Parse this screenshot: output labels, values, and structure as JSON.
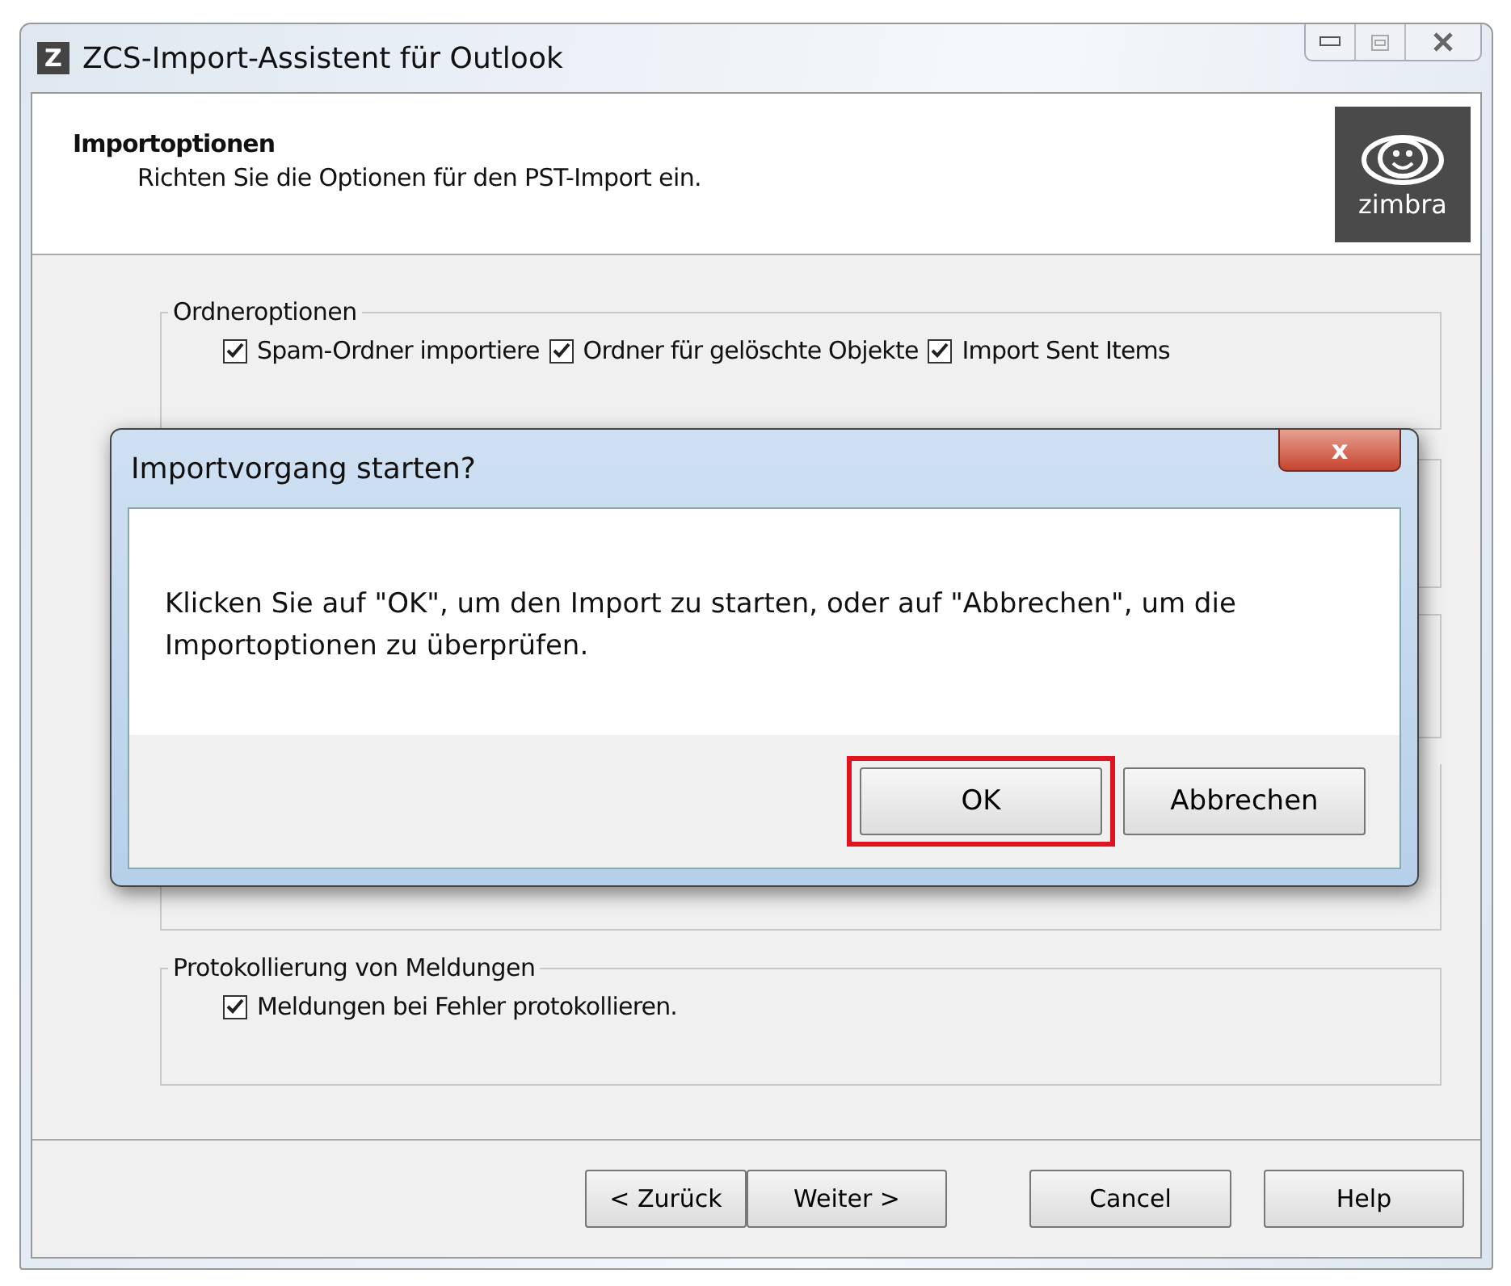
{
  "window": {
    "title": "ZCS-Import-Assistent für Outlook",
    "app_icon": "Z"
  },
  "header": {
    "title": "Importoptionen",
    "subtitle": "Richten Sie die Optionen für den PST-Import ein.",
    "logo_text": "zimbra"
  },
  "groups": [
    {
      "title": "Ordneroptionen",
      "options": [
        {
          "label": "Spam-Ordner importiere",
          "checked": true
        },
        {
          "label": "Ordner für gelöschte Objekte",
          "checked": true
        },
        {
          "label": "Import Sent Items",
          "checked": true
        }
      ]
    },
    {
      "title": "Protokollierung von Meldungen",
      "options": [
        {
          "label": "Meldungen bei Fehler protokollieren.",
          "checked": true
        }
      ]
    }
  ],
  "buttons": [
    "< Zurück",
    "Weiter >",
    "Cancel",
    "Help"
  ],
  "dialog": {
    "title": "Importvorgang starten?",
    "message": "Klicken Sie auf \"OK\", um den Import zu starten, oder auf \"Abbrechen\", um die Importoptionen zu überprüfen.",
    "close": "x",
    "buttons": [
      {
        "label": "OK",
        "highlighted": true
      },
      {
        "label": "Abbrechen",
        "highlighted": false
      }
    ]
  }
}
